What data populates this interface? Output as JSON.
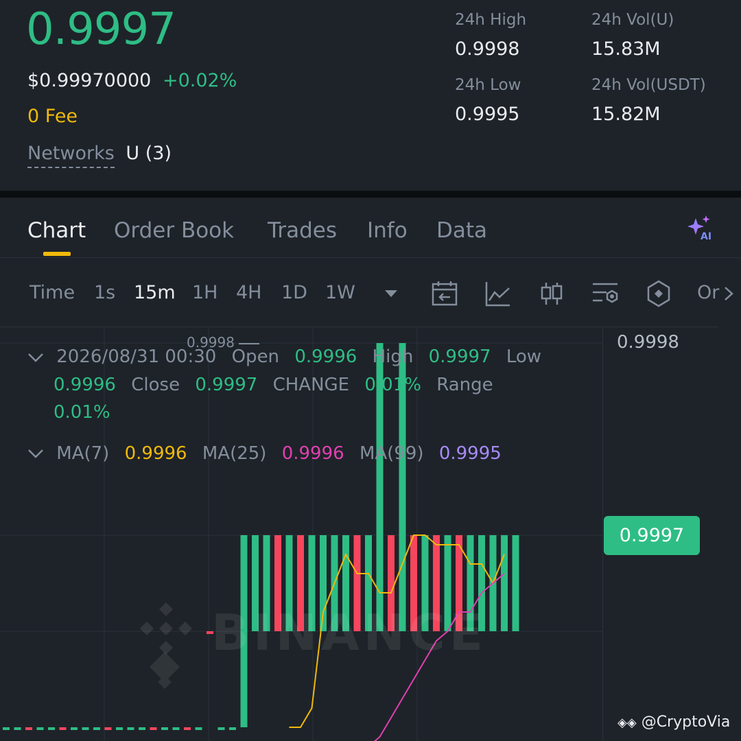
{
  "header": {
    "price": "0.9997",
    "usd_price": "$0.99970000",
    "change_pct": "+0.02%",
    "fee": "0 Fee",
    "networks_label": "Networks",
    "networks_value": "U (3)"
  },
  "stats": {
    "high_label": "24h High",
    "high_value": "0.9998",
    "vol_u_label": "24h Vol(U)",
    "vol_u_value": "15.83M",
    "low_label": "24h Low",
    "low_value": "0.9995",
    "vol_usdt_label": "24h Vol(USDT)",
    "vol_usdt_value": "15.82M"
  },
  "tabs": [
    "Chart",
    "Order Book",
    "Trades",
    "Info",
    "Data"
  ],
  "ai_label": "AI",
  "timeframes": {
    "time_label": "Time",
    "items": [
      "1s",
      "15m",
      "1H",
      "4H",
      "1D",
      "1W"
    ],
    "more_label": "Or"
  },
  "ohlc": {
    "date": "2026/08/31 00:30",
    "open_label": "Open",
    "open_value": "0.9996",
    "high_label": "High",
    "high_value": "0.9997",
    "low_label": "Low",
    "low_value": "0.9996",
    "close_label": "Close",
    "close_value": "0.9997",
    "change_label": "CHANGE",
    "change_value": "0.01%",
    "range_label": "Range",
    "range_value": "0.01%"
  },
  "ma": {
    "ma7_label": "MA(7)",
    "ma7_value": "0.9996",
    "ma25_label": "MA(25)",
    "ma25_value": "0.9996",
    "ma99_label": "MA(99)",
    "ma99_value": "0.9995"
  },
  "chart": {
    "axis_top_label": "0.9998",
    "high_marker_label": "0.9998",
    "current_price_tag": "0.9997",
    "watermark_text": "BINANCE",
    "credit": "@CryptoVia",
    "colors": {
      "up": "#2ebd85",
      "down": "#f6465d",
      "ma7": "#f0b90b",
      "ma25": "#e040b0",
      "ma99": "#a78bfa"
    }
  },
  "chart_data": {
    "type": "candlestick",
    "ylim": [
      0.9995,
      0.9998
    ],
    "candles": [
      {
        "o": 0.9995,
        "c": 0.9995,
        "dir": "up"
      },
      {
        "o": 0.9995,
        "c": 0.9995,
        "dir": "up"
      },
      {
        "o": 0.9995,
        "c": 0.9995,
        "dir": "down"
      },
      {
        "o": 0.9995,
        "c": 0.9995,
        "dir": "up"
      },
      {
        "o": 0.9995,
        "c": 0.9995,
        "dir": "up"
      },
      {
        "o": 0.9995,
        "c": 0.9995,
        "dir": "down"
      },
      {
        "o": 0.9995,
        "c": 0.9995,
        "dir": "up"
      },
      {
        "o": 0.9995,
        "c": 0.9995,
        "dir": "up"
      },
      {
        "o": 0.9995,
        "c": 0.9995,
        "dir": "up"
      },
      {
        "o": 0.9995,
        "c": 0.9995,
        "dir": "down"
      },
      {
        "o": 0.9995,
        "c": 0.9995,
        "dir": "up"
      },
      {
        "o": 0.9995,
        "c": 0.9995,
        "dir": "up"
      },
      {
        "o": 0.9995,
        "c": 0.9995,
        "dir": "up"
      },
      {
        "o": 0.9995,
        "c": 0.9995,
        "dir": "down"
      },
      {
        "o": 0.9995,
        "c": 0.9995,
        "dir": "up"
      },
      {
        "o": 0.9995,
        "c": 0.9995,
        "dir": "up"
      },
      {
        "o": 0.9995,
        "c": 0.9995,
        "dir": "down"
      },
      {
        "o": 0.9995,
        "c": 0.9995,
        "dir": "up"
      },
      {
        "o": 0.9996,
        "c": 0.9996,
        "dir": "down"
      },
      {
        "o": 0.9995,
        "c": 0.9995,
        "dir": "up"
      },
      {
        "o": 0.9995,
        "c": 0.9995,
        "dir": "up"
      },
      {
        "o": 0.9995,
        "c": 0.9997,
        "dir": "up"
      },
      {
        "o": 0.9996,
        "c": 0.9997,
        "dir": "up"
      },
      {
        "o": 0.9996,
        "c": 0.9997,
        "dir": "up"
      },
      {
        "o": 0.9997,
        "c": 0.9996,
        "dir": "down"
      },
      {
        "o": 0.9996,
        "c": 0.9997,
        "dir": "up"
      },
      {
        "o": 0.9997,
        "c": 0.9996,
        "dir": "down"
      },
      {
        "o": 0.9996,
        "c": 0.9997,
        "dir": "up"
      },
      {
        "o": 0.9996,
        "c": 0.9997,
        "dir": "up"
      },
      {
        "o": 0.9996,
        "c": 0.9997,
        "dir": "up"
      },
      {
        "o": 0.9996,
        "c": 0.9997,
        "dir": "up"
      },
      {
        "o": 0.9997,
        "c": 0.9996,
        "dir": "down"
      },
      {
        "o": 0.9996,
        "c": 0.9997,
        "dir": "up"
      },
      {
        "o": 0.9996,
        "c": 0.9998,
        "dir": "up"
      },
      {
        "o": 0.9997,
        "c": 0.9996,
        "dir": "down"
      },
      {
        "o": 0.9996,
        "c": 0.9998,
        "dir": "up"
      },
      {
        "o": 0.9997,
        "c": 0.9996,
        "dir": "down"
      },
      {
        "o": 0.9996,
        "c": 0.9997,
        "dir": "up"
      },
      {
        "o": 0.9997,
        "c": 0.9996,
        "dir": "down"
      },
      {
        "o": 0.9996,
        "c": 0.9997,
        "dir": "up"
      },
      {
        "o": 0.9997,
        "c": 0.9996,
        "dir": "down"
      },
      {
        "o": 0.9996,
        "c": 0.9997,
        "dir": "up"
      },
      {
        "o": 0.9996,
        "c": 0.9997,
        "dir": "up"
      },
      {
        "o": 0.9996,
        "c": 0.9997,
        "dir": "up"
      },
      {
        "o": 0.9996,
        "c": 0.9997,
        "dir": "up"
      },
      {
        "o": 0.9996,
        "c": 0.9997,
        "dir": "up"
      }
    ],
    "ma7": [
      0.9995,
      0.9995,
      0.99952,
      0.99962,
      0.99965,
      0.99968,
      0.99966,
      0.99966,
      0.99964,
      0.99964,
      0.99967,
      0.9997,
      0.9997,
      0.99969,
      0.99969,
      0.99969,
      0.99967,
      0.99967,
      0.99965,
      0.99968
    ],
    "ma25": [
      0.99948,
      0.99949,
      0.99951,
      0.99953,
      0.99955,
      0.99957,
      0.99959,
      0.9996,
      0.99962,
      0.99962,
      0.99964,
      0.99965,
      0.99966
    ]
  }
}
